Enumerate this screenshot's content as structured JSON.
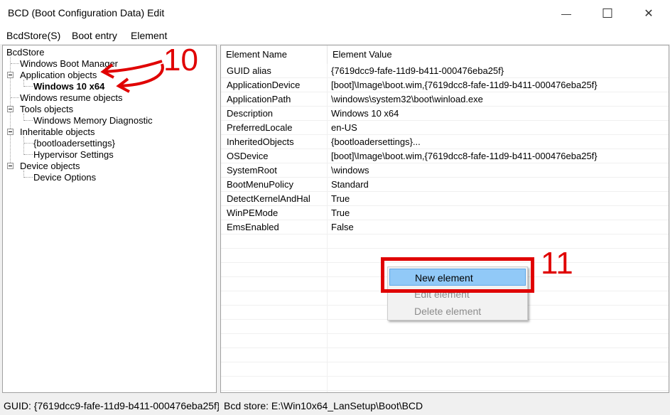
{
  "window": {
    "title": "BCD (Boot Configuration Data) Edit",
    "minimize_glyph": "—",
    "maximize_glyph": "☐",
    "close_glyph": "✕"
  },
  "menu": [
    "BcdStore(S)",
    "Boot entry",
    "Element"
  ],
  "tree": {
    "root": "BcdStore",
    "items": [
      "Windows Boot Manager",
      "Application objects",
      "Windows 10 x64",
      "Windows resume objects",
      "Tools objects",
      "Windows Memory Diagnostic",
      "Inheritable objects",
      "{bootloadersettings}",
      "Hypervisor Settings",
      "Device objects",
      "Device Options"
    ]
  },
  "list": {
    "headers": [
      "Element Name",
      "Element Value"
    ],
    "rows": [
      [
        "GUID alias",
        "{7619dcc9-fafe-11d9-b411-000476eba25f}"
      ],
      [
        "ApplicationDevice",
        "[boot]\\Image\\boot.wim,{7619dcc8-fafe-11d9-b411-000476eba25f}"
      ],
      [
        "ApplicationPath",
        "\\windows\\system32\\boot\\winload.exe"
      ],
      [
        "Description",
        "Windows 10 x64"
      ],
      [
        "PreferredLocale",
        "en-US"
      ],
      [
        "InheritedObjects",
        "{bootloadersettings}..."
      ],
      [
        "OSDevice",
        "[boot]\\Image\\boot.wim,{7619dcc8-fafe-11d9-b411-000476eba25f}"
      ],
      [
        "SystemRoot",
        "\\windows"
      ],
      [
        "BootMenuPolicy",
        "Standard"
      ],
      [
        "DetectKernelAndHal",
        "True"
      ],
      [
        "WinPEMode",
        "True"
      ],
      [
        "EmsEnabled",
        "False"
      ]
    ]
  },
  "context_menu": {
    "items": [
      "New element",
      "Edit element",
      "Delete element"
    ],
    "highlighted": "New element",
    "disabled": [
      "Edit element",
      "Delete element"
    ]
  },
  "status_bar": {
    "guid": "GUID:  {7619dcc9-fafe-11d9-b411-000476eba25f}",
    "store": "Bcd store:   E:\\Win10x64_LanSetup\\Boot\\BCD"
  },
  "annotations": {
    "step_10": "10",
    "step_11": "11",
    "color": "#e00000"
  }
}
